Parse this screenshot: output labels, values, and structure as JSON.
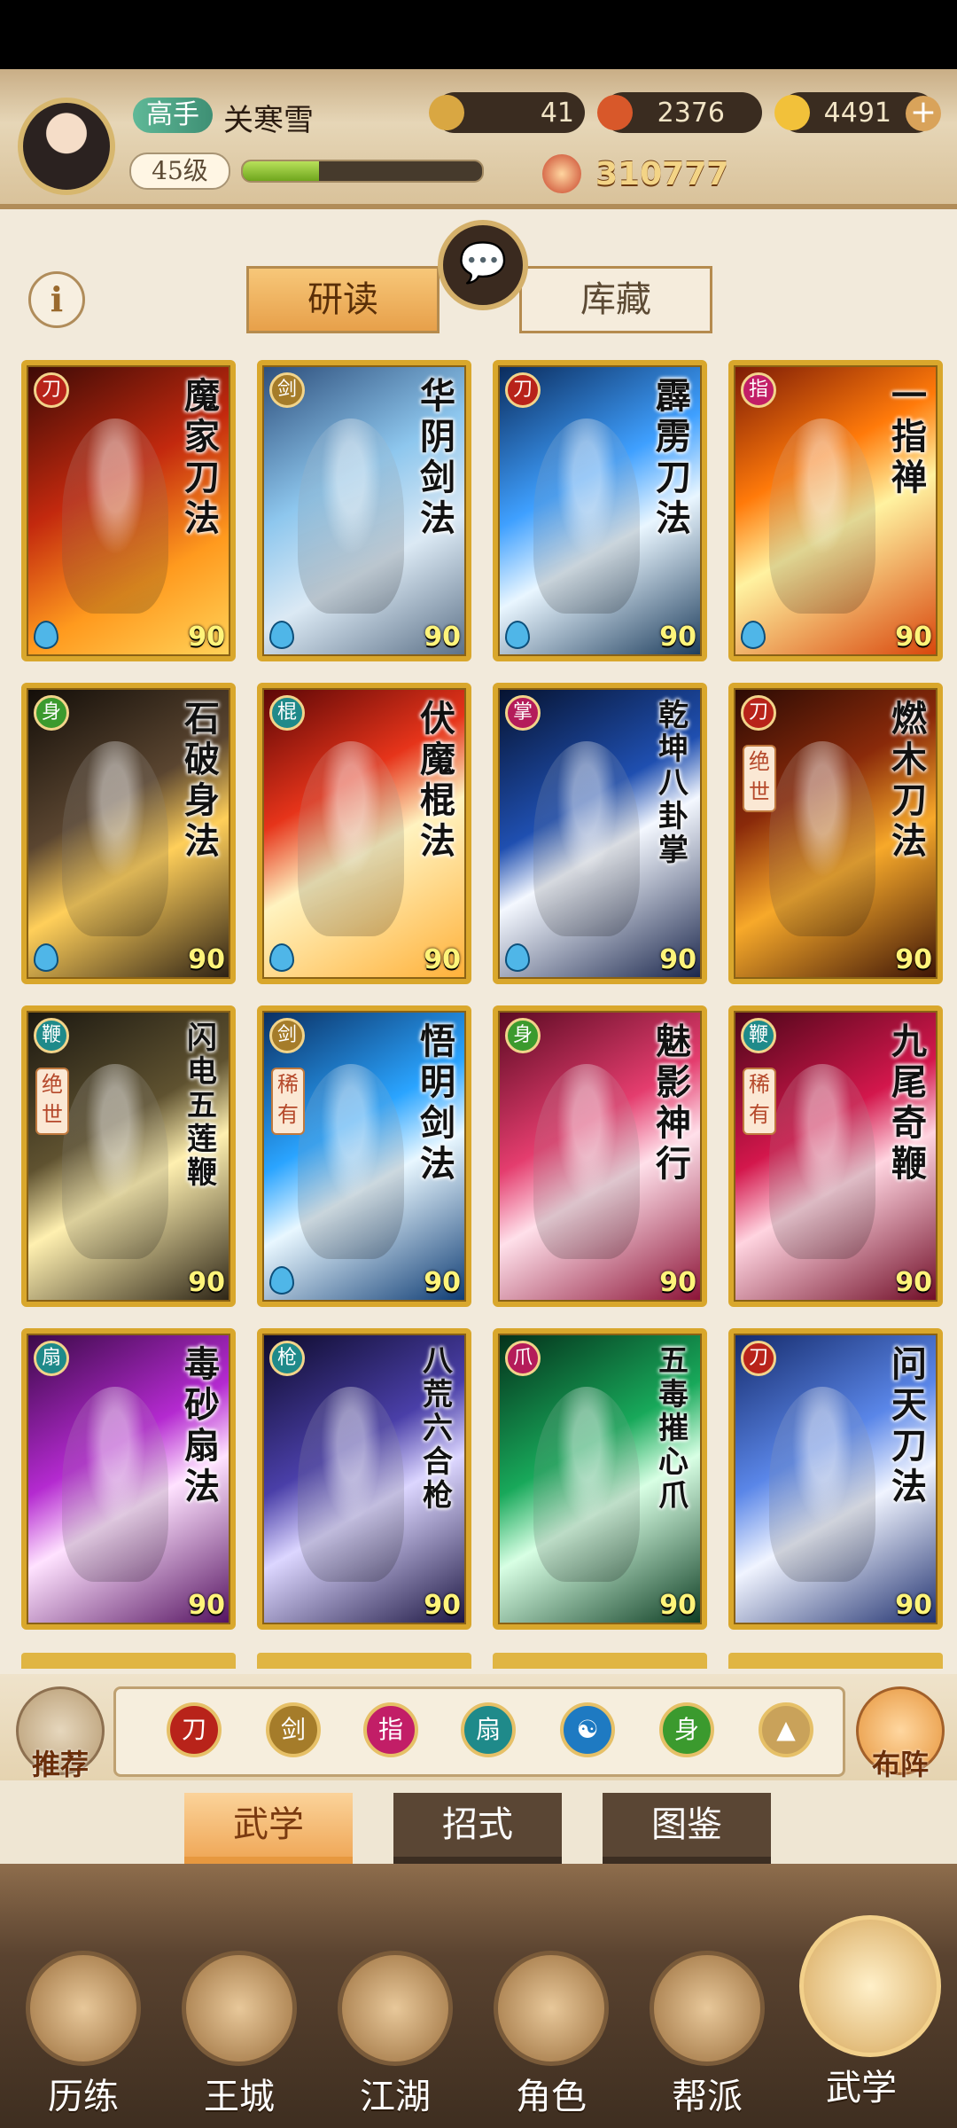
{
  "player": {
    "rank": "高手",
    "name": "关寒雪",
    "level": "45级",
    "xp_progress": 0.32,
    "power": "310777"
  },
  "currencies": [
    {
      "name": "copper-coin",
      "value": "41",
      "color": "#d9a742"
    },
    {
      "name": "flame-token",
      "value": "2376",
      "color": "#d8582a"
    },
    {
      "name": "gold-ingot",
      "value": "4491",
      "color": "#f2c13a"
    }
  ],
  "tabs_top": [
    "研读",
    "库藏"
  ],
  "cards": [
    {
      "title": "魔家刀法",
      "level": "90",
      "school": "blade",
      "rarity": "",
      "bg": "linear-gradient(150deg,#3b0a06,#c3290e 40%,#ff9a1e 70%,#ffd35a)"
    },
    {
      "title": "华阴剑法",
      "level": "90",
      "school": "sword",
      "rarity": "",
      "bg": "linear-gradient(150deg,#2c4d7a,#8ec7ee 40%,#dbe9f4 65%,#5a6f86)"
    },
    {
      "title": "霹雳刀法",
      "level": "90",
      "school": "blade",
      "rarity": "",
      "bg": "linear-gradient(150deg,#0a2a5a,#3fa0ff 40%,#e9f6ff 60%,#1a3a5a)"
    },
    {
      "title": "一指禅",
      "level": "90",
      "school": "finger",
      "rarity": "",
      "bg": "linear-gradient(150deg,#7a1a06,#ff7a0a 35%,#fff2a0 55%,#d8440a)"
    },
    {
      "title": "石破身法",
      "level": "90",
      "school": "body",
      "rarity": "",
      "bg": "linear-gradient(150deg,#120d08,#5a4530 40%,#ffcf5a 60%,#2a1f14)"
    },
    {
      "title": "伏魔棍法",
      "level": "90",
      "school": "staff",
      "rarity": "",
      "bg": "linear-gradient(150deg,#5a0606,#e6341a 35%,#fff3c0 55%,#ffb038)"
    },
    {
      "title": "乾坤八卦掌",
      "level": "90",
      "school": "palm",
      "rarity": "",
      "bg": "linear-gradient(150deg,#06122e,#1f4fb0 40%,#f4f8ff 55%,#18244a)"
    },
    {
      "title": "燃木刀法",
      "level": "90",
      "school": "blade",
      "rarity": "绝世",
      "bg": "linear-gradient(150deg,#2a0a04,#8a2a0a 35%,#f7a92a 60%,#3a1206)"
    },
    {
      "title": "闪电五莲鞭",
      "level": "90",
      "school": "whip",
      "rarity": "绝世",
      "bg": "linear-gradient(150deg,#1a1710,#5f5230 40%,#fff0b0 58%,#2a2214)"
    },
    {
      "title": "悟明剑法",
      "level": "90",
      "school": "sword",
      "rarity": "稀有",
      "bg": "linear-gradient(150deg,#0a2e60,#2aa4ff 40%,#e8f7ff 58%,#0c3a72)"
    },
    {
      "title": "魅影神行",
      "level": "90",
      "school": "body",
      "rarity": "",
      "bg": "linear-gradient(150deg,#5a0a22,#e43d6e 40%,#ffe0ea 58%,#8a1034)"
    },
    {
      "title": "九尾奇鞭",
      "level": "90",
      "school": "whip",
      "rarity": "稀有",
      "bg": "linear-gradient(150deg,#4a0618,#d3174c 40%,#ffd4e0 58%,#6e0a24)"
    },
    {
      "title": "毒砂扇法",
      "level": "90",
      "school": "fan",
      "rarity": "",
      "bg": "linear-gradient(150deg,#3a0a46,#b42ad0 40%,#ffe2ff 58%,#52105e)"
    },
    {
      "title": "八荒六合枪",
      "level": "90",
      "school": "spear",
      "rarity": "",
      "bg": "linear-gradient(150deg,#0d0a2a,#4a3fa8 40%,#dcd6ff 58%,#1a1440)"
    },
    {
      "title": "五毒摧心爪",
      "level": "90",
      "school": "claw",
      "rarity": "",
      "bg": "linear-gradient(150deg,#04301a,#18a85a 40%,#d8ffe4 58%,#0a3a20)"
    },
    {
      "title": "问天刀法",
      "level": "90",
      "school": "blade",
      "rarity": "",
      "bg": "linear-gradient(150deg,#152a6a,#5a86e8 40%,#f0f4ff 60%,#1e2f6e)"
    }
  ],
  "school_colors": {
    "blade": "#b8231a",
    "sword": "#a57c2a",
    "finger": "#c21e67",
    "body": "#3b9a2e",
    "staff": "#1f8a8a",
    "palm": "#b41c5a",
    "whip": "#1f8a8a",
    "fan": "#1f8a8a",
    "spear": "#1f8a8a",
    "claw": "#b41c5a"
  },
  "filters": [
    {
      "icon": "blade-school-icon",
      "color": "#b8231a",
      "glyph": "刀"
    },
    {
      "icon": "sword-school-icon",
      "color": "#a57c2a",
      "glyph": "剑"
    },
    {
      "icon": "finger-school-icon",
      "color": "#c21e67",
      "glyph": "指"
    },
    {
      "icon": "fan-school-icon",
      "color": "#1f8a8a",
      "glyph": "扇"
    },
    {
      "icon": "taiji-school-icon",
      "color": "#1e7ac2",
      "glyph": "☯"
    },
    {
      "icon": "body-school-icon",
      "color": "#3b9a2e",
      "glyph": "身"
    },
    {
      "icon": "expand-up-icon",
      "color": "#c9a25a",
      "glyph": "▲"
    }
  ],
  "side_buttons": {
    "recommend": "推荐",
    "formation": "布阵"
  },
  "sub_tabs": [
    "武学",
    "招式",
    "图鉴"
  ],
  "nav": [
    "历练",
    "王城",
    "江湖",
    "角色",
    "帮派",
    "武学"
  ]
}
